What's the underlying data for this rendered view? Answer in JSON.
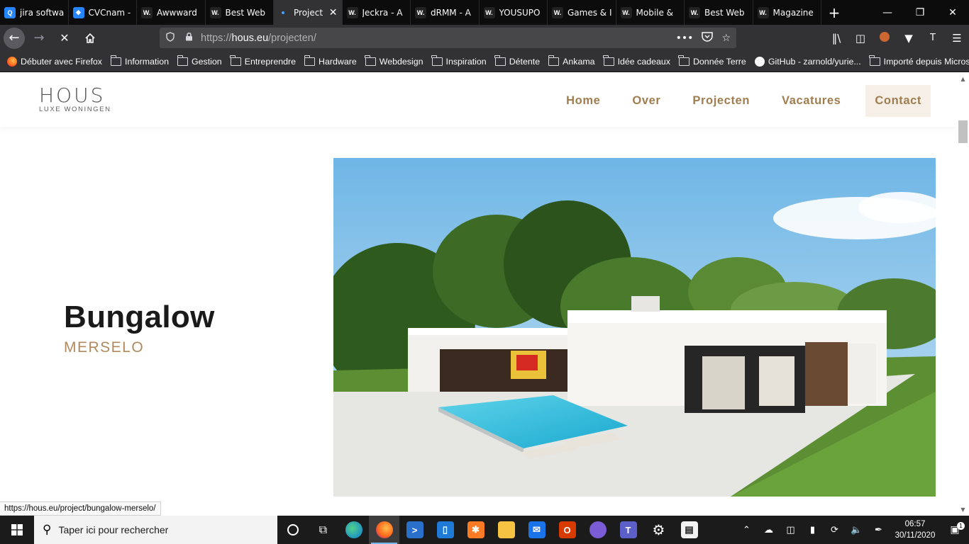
{
  "browser": {
    "tabs": [
      {
        "title": "jira softwa",
        "favicon": "Q",
        "color": "#2684ff"
      },
      {
        "title": "CVCnam -",
        "favicon": "◆",
        "color": "#2684ff"
      },
      {
        "title": "Awwward",
        "favicon": "W.",
        "color": "#222222"
      },
      {
        "title": "Best Web",
        "favicon": "W.",
        "color": "#222222"
      },
      {
        "title": "Project",
        "favicon": "",
        "color": "#323234",
        "active": true
      },
      {
        "title": "Jeckra - A",
        "favicon": "W.",
        "color": "#222222"
      },
      {
        "title": "dRMM - A",
        "favicon": "W.",
        "color": "#222222"
      },
      {
        "title": "YOUSUPO",
        "favicon": "W.",
        "color": "#222222"
      },
      {
        "title": "Games & I",
        "favicon": "W.",
        "color": "#222222"
      },
      {
        "title": "Mobile &",
        "favicon": "W.",
        "color": "#222222"
      },
      {
        "title": "Best Web",
        "favicon": "W.",
        "color": "#222222"
      },
      {
        "title": "Magazine",
        "favicon": "W.",
        "color": "#222222"
      }
    ],
    "url_scheme": "https://",
    "url_host": "hous.eu",
    "url_path": "/projecten/",
    "bookmarks": [
      {
        "label": "Débuter avec Firefox",
        "icon": "firefox-icon"
      },
      {
        "label": "Information",
        "icon": "folder-icon"
      },
      {
        "label": "Gestion",
        "icon": "folder-icon"
      },
      {
        "label": "Entreprendre",
        "icon": "folder-icon"
      },
      {
        "label": "Hardware",
        "icon": "folder-icon"
      },
      {
        "label": "Webdesign",
        "icon": "folder-icon"
      },
      {
        "label": "Inspiration",
        "icon": "folder-icon"
      },
      {
        "label": "Détente",
        "icon": "folder-icon"
      },
      {
        "label": "Ankama",
        "icon": "folder-icon"
      },
      {
        "label": "Idée cadeaux",
        "icon": "folder-icon"
      },
      {
        "label": "Donnée Terre",
        "icon": "folder-icon"
      },
      {
        "label": "GitHub - zarnold/yurie...",
        "icon": "github-icon"
      },
      {
        "label": "Importé depuis Micros...",
        "icon": "folder-icon"
      }
    ],
    "status_link": "https://hous.eu/project/bungalow-merselo/"
  },
  "site": {
    "logo_name": "HOUS",
    "logo_sub": "LUXE WONINGEN",
    "menu": [
      "Home",
      "Over",
      "Projecten",
      "Vacatures",
      "Contact"
    ],
    "project_title": "Bungalow",
    "project_location": "MERSELO",
    "accent": "#a07d4f"
  },
  "taskbar": {
    "search_placeholder": "Taper ici pour rechercher",
    "time": "06:57",
    "date": "30/11/2020",
    "notification_count": "1"
  }
}
